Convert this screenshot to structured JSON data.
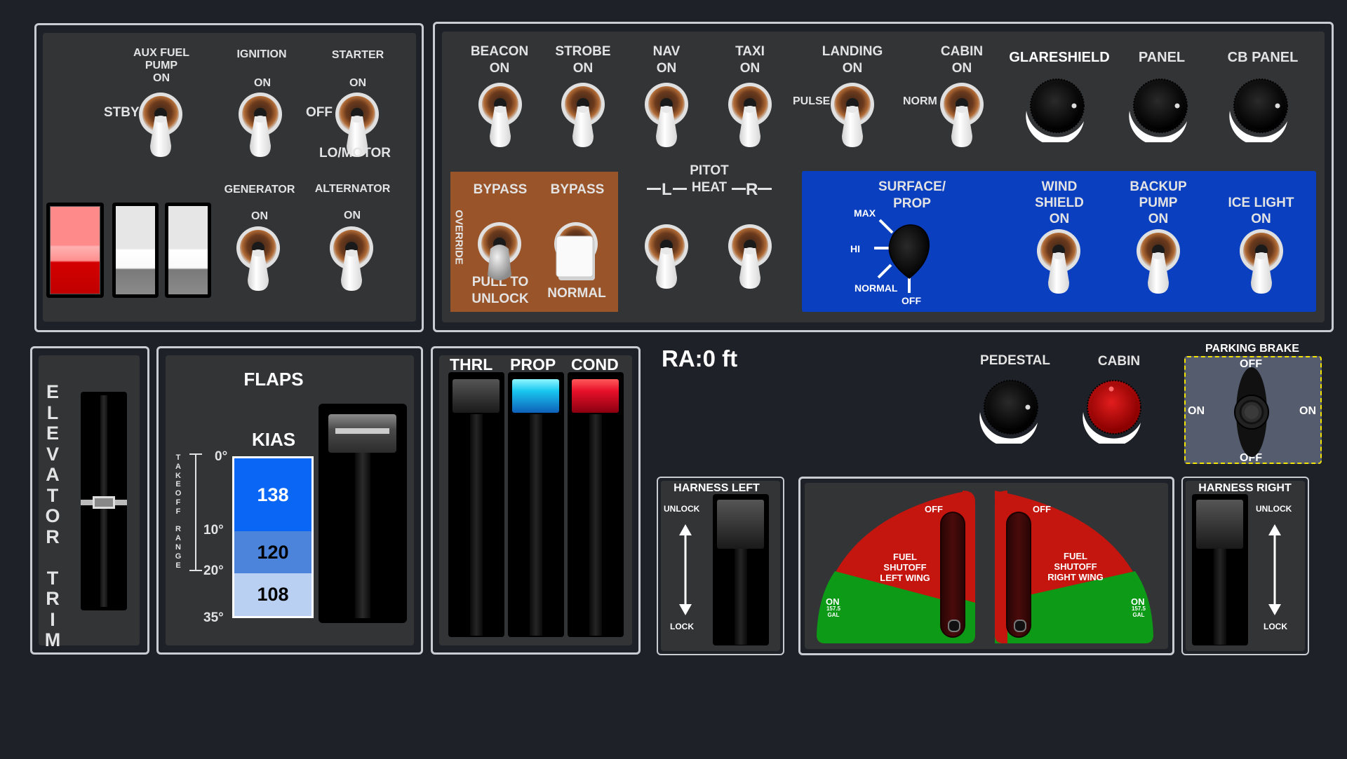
{
  "colors": {
    "background": "#1e2127",
    "panel": "#333436",
    "blue_panel": "#0a3fbf",
    "brown_panel": "#9a542a",
    "red_light": "#e8102a",
    "cyan_light": "#19c7f0",
    "fuel_red": "#c4150f",
    "fuel_green": "#0c9a17"
  },
  "left_panel": {
    "aux_fuel_pump": {
      "line1": "AUX FUEL",
      "line2": "PUMP",
      "line3": "ON",
      "left": "STBY"
    },
    "ignition": {
      "title": "IGNITION",
      "on": "ON"
    },
    "starter": {
      "title": "STARTER",
      "on": "ON",
      "left": "OFF",
      "bottom": "LO/MOTOR"
    },
    "generator": {
      "title": "GENERATOR",
      "on": "ON"
    },
    "alternator": {
      "title": "ALTERNATOR",
      "on": "ON"
    }
  },
  "lights_panel": {
    "beacon": {
      "title": "BEACON",
      "on": "ON"
    },
    "strobe": {
      "title": "STROBE",
      "on": "ON"
    },
    "nav": {
      "title": "NAV",
      "on": "ON"
    },
    "taxi": {
      "title": "TAXI",
      "on": "ON"
    },
    "landing": {
      "title": "LANDING",
      "on": "ON",
      "left": "PULSE"
    },
    "cabin": {
      "title": "CABIN",
      "on": "ON",
      "left": "NORM"
    },
    "glareshield": "GLARESHIELD",
    "panel": "PANEL",
    "cb_panel": "CB PANEL"
  },
  "override": {
    "side": "OVERRIDE",
    "bypass1": "BYPASS",
    "bypass2": "BYPASS",
    "pull1": "PULL TO",
    "pull2": "UNLOCK",
    "normal": "NORMAL"
  },
  "pitot": {
    "line1": "PITOT",
    "line2": "HEAT",
    "left": "L",
    "right": "R"
  },
  "ice": {
    "surface1": "SURFACE/",
    "surface2": "PROP",
    "max": "MAX",
    "hi": "HI",
    "normal": "NORMAL",
    "off": "OFF",
    "windshield": {
      "l1": "WIND",
      "l2": "SHIELD",
      "l3": "ON"
    },
    "backup_pump": {
      "l1": "BACKUP",
      "l2": "PUMP",
      "l3": "ON"
    },
    "ice_light": {
      "l1": "ICE LIGHT",
      "l2": "ON"
    }
  },
  "elevator_trim": "ELEVATOR TRIM",
  "flaps": {
    "title": "FLAPS",
    "kias": "KIAS",
    "range_label": "TAKEOFF RANGE",
    "settings": [
      "0°",
      "10°",
      "20°",
      "35°"
    ],
    "speeds": [
      "138",
      "120",
      "108"
    ]
  },
  "engine_levers": {
    "thrl": "THRL",
    "prop": "PROP",
    "cond": "COND"
  },
  "ra": "RA:0 ft",
  "pedestal": "PEDESTAL",
  "cabin_knob": "CABIN",
  "parking_brake": {
    "title": "PARKING BRAKE",
    "top": "OFF",
    "bottom": "OFF",
    "left": "ON",
    "right": "ON"
  },
  "harness_left": {
    "title": "HARNESS LEFT",
    "unlock": "UNLOCK",
    "lock": "LOCK"
  },
  "harness_right": {
    "title": "HARNESS RIGHT",
    "unlock": "UNLOCK",
    "lock": "LOCK"
  },
  "fuel_shutoff": {
    "left": {
      "off": "OFF",
      "l1": "FUEL",
      "l2": "SHUTOFF",
      "l3": "LEFT WING",
      "on": "ON",
      "gal1": "157.5",
      "gal2": "GAL"
    },
    "right": {
      "off": "OFF",
      "l1": "FUEL",
      "l2": "SHUTOFF",
      "l3": "RIGHT WING",
      "on": "ON",
      "gal1": "157.5",
      "gal2": "GAL"
    }
  }
}
